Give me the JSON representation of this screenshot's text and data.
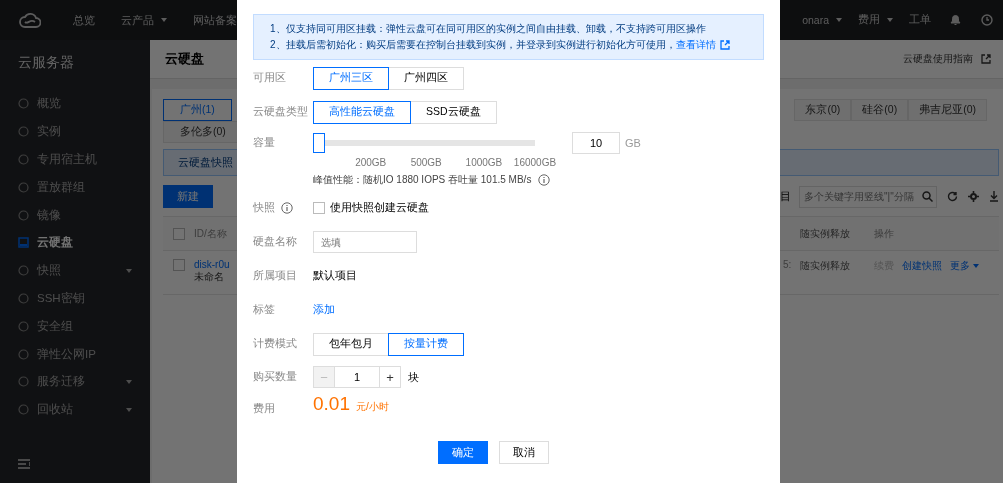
{
  "topbar": {
    "nav": [
      {
        "label": "总览",
        "dropdown": false
      },
      {
        "label": "云产品",
        "dropdown": true
      },
      {
        "label": "网站备案",
        "dropdown": false
      }
    ],
    "right": [
      {
        "label": "onara",
        "dropdown": true
      },
      {
        "label": "费用",
        "dropdown": true
      },
      {
        "label": "工单",
        "dropdown": false
      }
    ]
  },
  "sidebar": {
    "title": "云服务器",
    "items": [
      {
        "label": "概览",
        "selected": false,
        "expandable": false
      },
      {
        "label": "实例",
        "selected": false,
        "expandable": false
      },
      {
        "label": "专用宿主机",
        "selected": false,
        "expandable": false
      },
      {
        "label": "置放群组",
        "selected": false,
        "expandable": false
      },
      {
        "label": "镜像",
        "selected": false,
        "expandable": false
      },
      {
        "label": "云硬盘",
        "selected": true,
        "expandable": false
      },
      {
        "label": "快照",
        "selected": false,
        "expandable": true
      },
      {
        "label": "SSH密钥",
        "selected": false,
        "expandable": false
      },
      {
        "label": "安全组",
        "selected": false,
        "expandable": false
      },
      {
        "label": "弹性公网IP",
        "selected": false,
        "expandable": false
      },
      {
        "label": "服务迁移",
        "selected": false,
        "expandable": true
      },
      {
        "label": "回收站",
        "selected": false,
        "expandable": true
      }
    ]
  },
  "main": {
    "title": "云硬盘",
    "guide_link": "云硬盘使用指南",
    "region_tabs": {
      "left": [
        {
          "label": "广州(1)",
          "selected": true
        }
      ],
      "right": [
        {
          "label": "东京(0)",
          "selected": false
        },
        {
          "label": "硅谷(0)",
          "selected": false
        },
        {
          "label": "弗吉尼亚(0)",
          "selected": false
        }
      ],
      "second_row": [
        {
          "label": "多伦多(0)",
          "selected": false
        }
      ]
    },
    "notice": "云硬盘快照",
    "create_button": "新建",
    "filter_label": "目",
    "search": {
      "placeholder": "多个关键字用竖线\"|\"分隔"
    },
    "table": {
      "select_all_checked": false,
      "columns": [
        "ID/名称",
        "随实例释放",
        "操作"
      ],
      "rows": [
        {
          "checked": false,
          "id": "disk-r0u",
          "name": "未命名",
          "column_3": "5:",
          "release": "随实例释放",
          "actions": [
            {
              "label": "续费",
              "disabled": true,
              "dropdown": false
            },
            {
              "label": "创建快照",
              "disabled": false,
              "dropdown": false
            },
            {
              "label": "更多",
              "disabled": false,
              "dropdown": true
            }
          ]
        }
      ]
    }
  },
  "dialog": {
    "notice": [
      "1、仅支持同可用区挂载：弹性云盘可在同可用区的实例之间自由挂载、卸载，不支持跨可用区操作",
      "2、挂载后需初始化：购买后需要在控制台挂载到实例，并登录到实例进行初始化方可使用，"
    ],
    "notice_link": "查看详情",
    "zone": {
      "label": "可用区",
      "options": [
        {
          "label": "广州三区",
          "selected": true
        },
        {
          "label": "广州四区",
          "selected": false
        }
      ]
    },
    "disk_type": {
      "label": "云硬盘类型",
      "options": [
        {
          "label": "高性能云硬盘",
          "selected": true
        },
        {
          "label": "SSD云硬盘",
          "selected": false
        }
      ]
    },
    "capacity": {
      "label": "容量",
      "level": 0,
      "ticks": [
        "200GB",
        "500GB",
        "1000GB",
        "16000GB"
      ],
      "value": "10",
      "unit": "GB",
      "performance": "峰值性能：随机IO 1880 IOPS  吞吐量 101.5 MB/s"
    },
    "snapshot": {
      "label": "快照",
      "checked": false,
      "option": "使用快照创建云硬盘"
    },
    "disk_name": {
      "label": "硬盘名称",
      "placeholder": "选填"
    },
    "project": {
      "label": "所属项目",
      "value": "默认项目"
    },
    "tags": {
      "label": "标签",
      "link": "添加"
    },
    "billing": {
      "label": "计费模式",
      "options": [
        {
          "label": "包年包月",
          "selected": false
        },
        {
          "label": "按量计费",
          "selected": true
        }
      ]
    },
    "quantity": {
      "label": "购买数量",
      "minus": {
        "label": "−",
        "disabled": true
      },
      "value": "1",
      "plus": {
        "label": "+",
        "disabled": false
      },
      "unit": "块"
    },
    "fee": {
      "label": "费用",
      "amount": "0.01",
      "unit": "元/小时"
    },
    "buttons": [
      {
        "label": "确定",
        "kind": "primary"
      },
      {
        "label": "取消",
        "kind": "default"
      }
    ]
  }
}
